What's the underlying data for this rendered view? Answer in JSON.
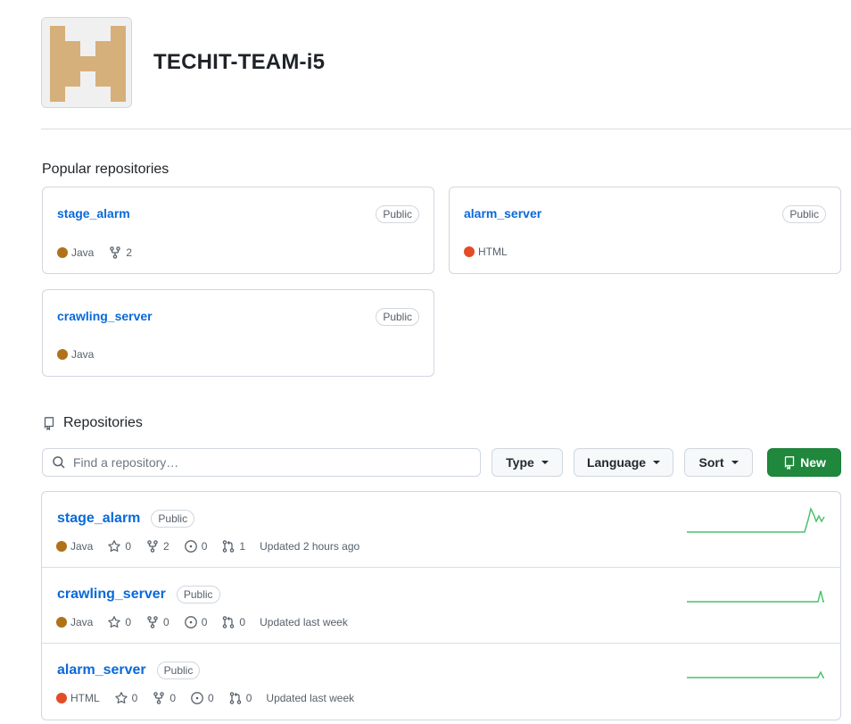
{
  "org": {
    "name": "TECHIT-TEAM-i5"
  },
  "popular": {
    "title": "Popular repositories",
    "cards": [
      {
        "name": "stage_alarm",
        "visibility": "Public",
        "language": "Java",
        "lang_color": "#b07219",
        "forks": "2"
      },
      {
        "name": "alarm_server",
        "visibility": "Public",
        "language": "HTML",
        "lang_color": "#e34c26"
      },
      {
        "name": "crawling_server",
        "visibility": "Public",
        "language": "Java",
        "lang_color": "#b07219"
      }
    ]
  },
  "repositories": {
    "title": "Repositories",
    "search_placeholder": "Find a repository…",
    "type_label": "Type",
    "language_label": "Language",
    "sort_label": "Sort",
    "new_label": "New",
    "items": [
      {
        "name": "stage_alarm",
        "visibility": "Public",
        "language": "Java",
        "lang_color": "#b07219",
        "stars": "0",
        "forks": "2",
        "issues": "0",
        "pulls": "1",
        "updated": "Updated 2 hours ago"
      },
      {
        "name": "crawling_server",
        "visibility": "Public",
        "language": "Java",
        "lang_color": "#b07219",
        "stars": "0",
        "forks": "0",
        "issues": "0",
        "pulls": "0",
        "updated": "Updated last week"
      },
      {
        "name": "alarm_server",
        "visibility": "Public",
        "language": "HTML",
        "lang_color": "#e34c26",
        "stars": "0",
        "forks": "0",
        "issues": "0",
        "pulls": "0",
        "updated": "Updated last week"
      }
    ]
  },
  "colors": {
    "link": "#0969da",
    "primary_button": "#1f883d",
    "sparkline": "#4ac26b"
  },
  "icons": {
    "repo": "repo-icon",
    "star": "star-icon",
    "fork": "fork-icon",
    "issue": "issue-icon",
    "pull": "pull-request-icon",
    "search": "search-icon"
  }
}
